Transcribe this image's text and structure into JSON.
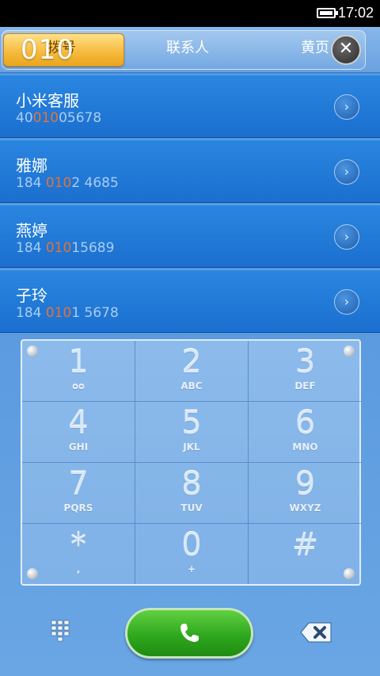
{
  "status_bar": {
    "time": "17:02"
  },
  "tabs": {
    "dial_label": "拨号",
    "contacts_label": "联系人",
    "yellow_pages_label": "黄页"
  },
  "dialer": {
    "typed_number": "010"
  },
  "contacts": [
    {
      "name": "小米客服",
      "number_prefix": "40",
      "number_match": "010",
      "number_suffix": "05678"
    },
    {
      "name": "雅娜",
      "number_prefix": "184 ",
      "number_match": "010",
      "number_suffix": "2 4685"
    },
    {
      "name": "燕婷",
      "number_prefix": "184 ",
      "number_match": "010",
      "number_suffix": "15689"
    },
    {
      "name": "子玲",
      "number_prefix": "184 ",
      "number_match": "010",
      "number_suffix": "1 5678"
    }
  ],
  "keypad": [
    {
      "digit": "1",
      "letters": "ᴑᴑ"
    },
    {
      "digit": "2",
      "letters": "ABC"
    },
    {
      "digit": "3",
      "letters": "DEF"
    },
    {
      "digit": "4",
      "letters": "GHI"
    },
    {
      "digit": "5",
      "letters": "JKL"
    },
    {
      "digit": "6",
      "letters": "MNO"
    },
    {
      "digit": "7",
      "letters": "PQRS"
    },
    {
      "digit": "8",
      "letters": "TUV"
    },
    {
      "digit": "9",
      "letters": "WXYZ"
    },
    {
      "digit": "*",
      "letters": ","
    },
    {
      "digit": "0",
      "letters": "+"
    },
    {
      "digit": "#",
      "letters": ""
    }
  ],
  "colors": {
    "match_highlight": "#e0733d",
    "call_green": "#2fa81e",
    "active_tab": "#f5b93a"
  },
  "icons": {
    "clear": "close-icon",
    "row_action": "chevron-right-icon",
    "dialpad": "dialpad-grid-icon",
    "call": "phone-icon",
    "backspace": "backspace-icon"
  }
}
